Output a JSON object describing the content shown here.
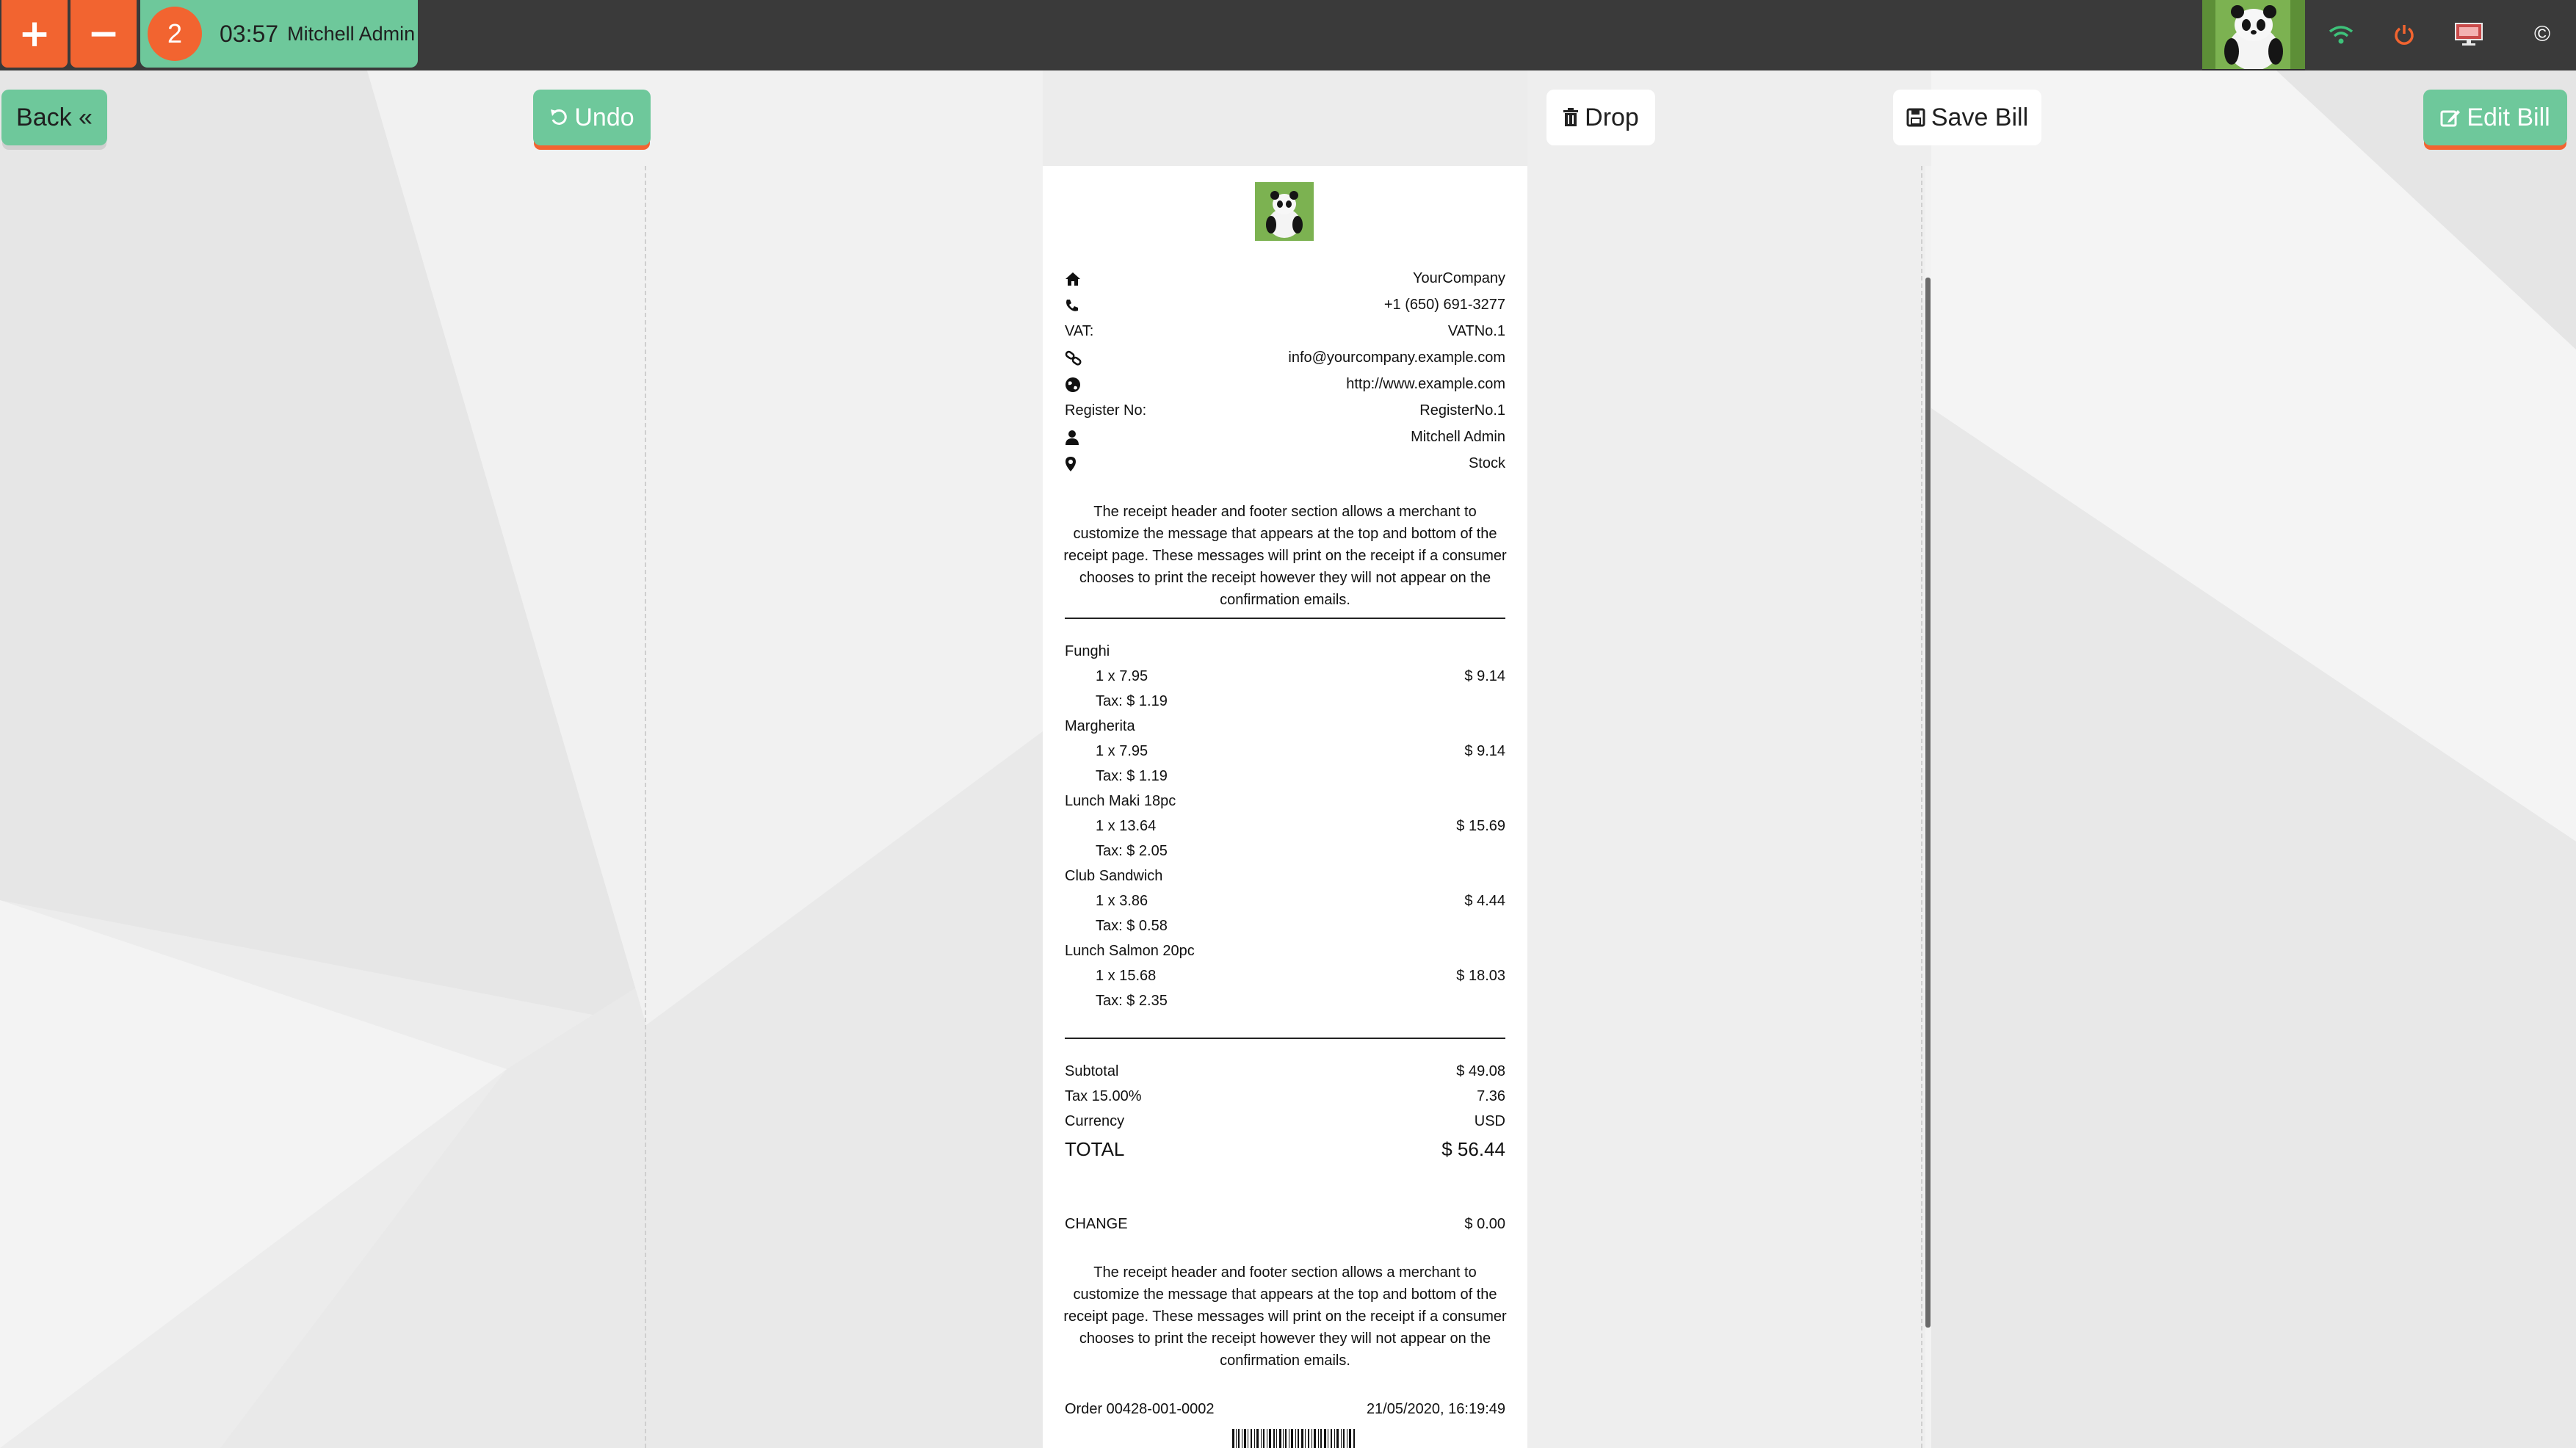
{
  "topbar": {
    "add_label": "+",
    "remove_label": "−",
    "order": {
      "count": "2",
      "time": "03:57",
      "user": "Mitchell Admin"
    },
    "close_label": "©"
  },
  "actions": {
    "back": "Back «",
    "undo": "Undo",
    "drop": "Drop",
    "save": "Save Bill",
    "edit": "Edit Bill"
  },
  "receipt": {
    "company": "YourCompany",
    "phone": "+1 (650) 691-3277",
    "vat_label": "VAT:",
    "vat_value": "VATNo.1",
    "email": "info@yourcompany.example.com",
    "website": "http://www.example.com",
    "register_label": "Register No:",
    "register_value": "RegisterNo.1",
    "cashier": "Mitchell Admin",
    "location": "Stock",
    "header_msg": "The receipt header and footer section allows a merchant to customize the message that appears at the top and bottom of the receipt page. These messages will print on the receipt if a consumer chooses to print the receipt however they will not appear on the confirmation emails.",
    "lines": [
      {
        "name": "Funghi",
        "qty": "1 x 7.95",
        "price": "$ 9.14",
        "tax": "Tax: $ 1.19"
      },
      {
        "name": "Margherita",
        "qty": "1 x 7.95",
        "price": "$ 9.14",
        "tax": "Tax: $ 1.19"
      },
      {
        "name": "Lunch Maki 18pc",
        "qty": "1 x 13.64",
        "price": "$ 15.69",
        "tax": "Tax: $ 2.05"
      },
      {
        "name": "Club Sandwich",
        "qty": "1 x 3.86",
        "price": "$ 4.44",
        "tax": "Tax: $ 0.58"
      },
      {
        "name": "Lunch Salmon 20pc",
        "qty": "1 x 15.68",
        "price": "$ 18.03",
        "tax": "Tax: $ 2.35"
      }
    ],
    "subtotal_label": "Subtotal",
    "subtotal_value": "$ 49.08",
    "tax_label": "Tax 15.00%",
    "tax_value": "7.36",
    "currency_label": "Currency",
    "currency_value": "USD",
    "total_label": "TOTAL",
    "total_value": "$ 56.44",
    "change_label": "CHANGE",
    "change_value": "$ 0.00",
    "footer_msg": "The receipt header and footer section allows a merchant to customize the message that appears at the top and bottom of the receipt page. These messages will print on the receipt if a consumer chooses to print the receipt however they will not appear on the confirmation emails.",
    "order_ref": "Order 00428-001-0002",
    "order_date": "21/05/2020, 16:19:49"
  },
  "colors": {
    "accent": "#f26430",
    "green": "#6ec89b",
    "topbar": "#3a3a3a",
    "wifi": "#3ec27a"
  },
  "icons": [
    "home-icon",
    "phone-icon",
    "link-icon",
    "globe-icon",
    "user-icon",
    "map-marker-icon",
    "wifi-icon",
    "power-icon",
    "monitor-icon",
    "trash-icon",
    "save-icon",
    "undo-icon",
    "edit-icon"
  ]
}
